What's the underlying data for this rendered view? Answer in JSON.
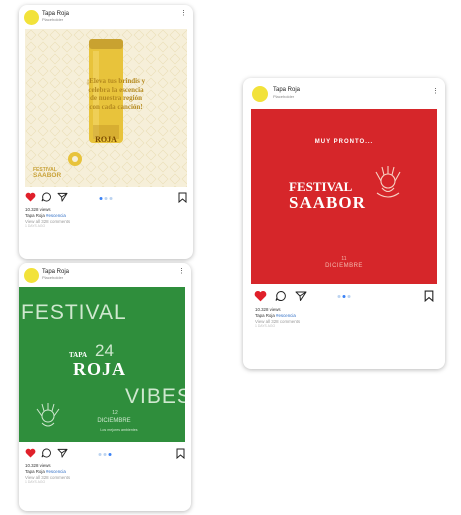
{
  "posts": [
    {
      "username": "Tapa Roja",
      "location": "Placeholder",
      "media_text": {
        "quote_line1": "¡Eleva tus brindis y",
        "quote_line2": "celebra la escencia",
        "quote_line3": "de nuestra región",
        "quote_line4": "con cada canción!",
        "can_label": "ROJA",
        "badge_line1": "FESTIVAL",
        "badge_line2": "SAABOR"
      },
      "views": "10.328 views",
      "caption_user": "Tapa Roja",
      "caption_tag": "#escencia",
      "comments": "View all 328 comments",
      "time": "1 DAYS AGO",
      "colors": {
        "bg": "#f6efd9",
        "accent": "#c9a33a"
      }
    },
    {
      "username": "Tapa Roja",
      "location": "Placeholder",
      "media_text": {
        "top": "MUY PRONTO...",
        "title1": "FESTIVAL",
        "title2": "SAABOR",
        "day": "11",
        "month": "DICIEMBRE"
      },
      "views": "10.328 views",
      "caption_user": "Tapa Roja",
      "caption_tag": "#escencia",
      "comments": "View all 328 comments",
      "time": "1 DAYS AGO",
      "colors": {
        "bg": "#d6262a",
        "accent": "#ffffff"
      }
    },
    {
      "username": "Tapa Roja",
      "location": "Placeholder",
      "media_text": {
        "word1": "FESTIVAL",
        "brand_small": "TAPA",
        "brand_num": "24",
        "brand_big": "ROJA",
        "word2": "VIBES",
        "day": "12",
        "month": "DICIEMBRE",
        "tagline": "Los mejores ambientes"
      },
      "views": "10.328 views",
      "caption_user": "Tapa Roja",
      "caption_tag": "#escencia",
      "comments": "View all 328 comments",
      "time": "1 DAYS AGO",
      "colors": {
        "bg": "#2f8e3c",
        "accent": "#ffffff"
      }
    }
  ]
}
